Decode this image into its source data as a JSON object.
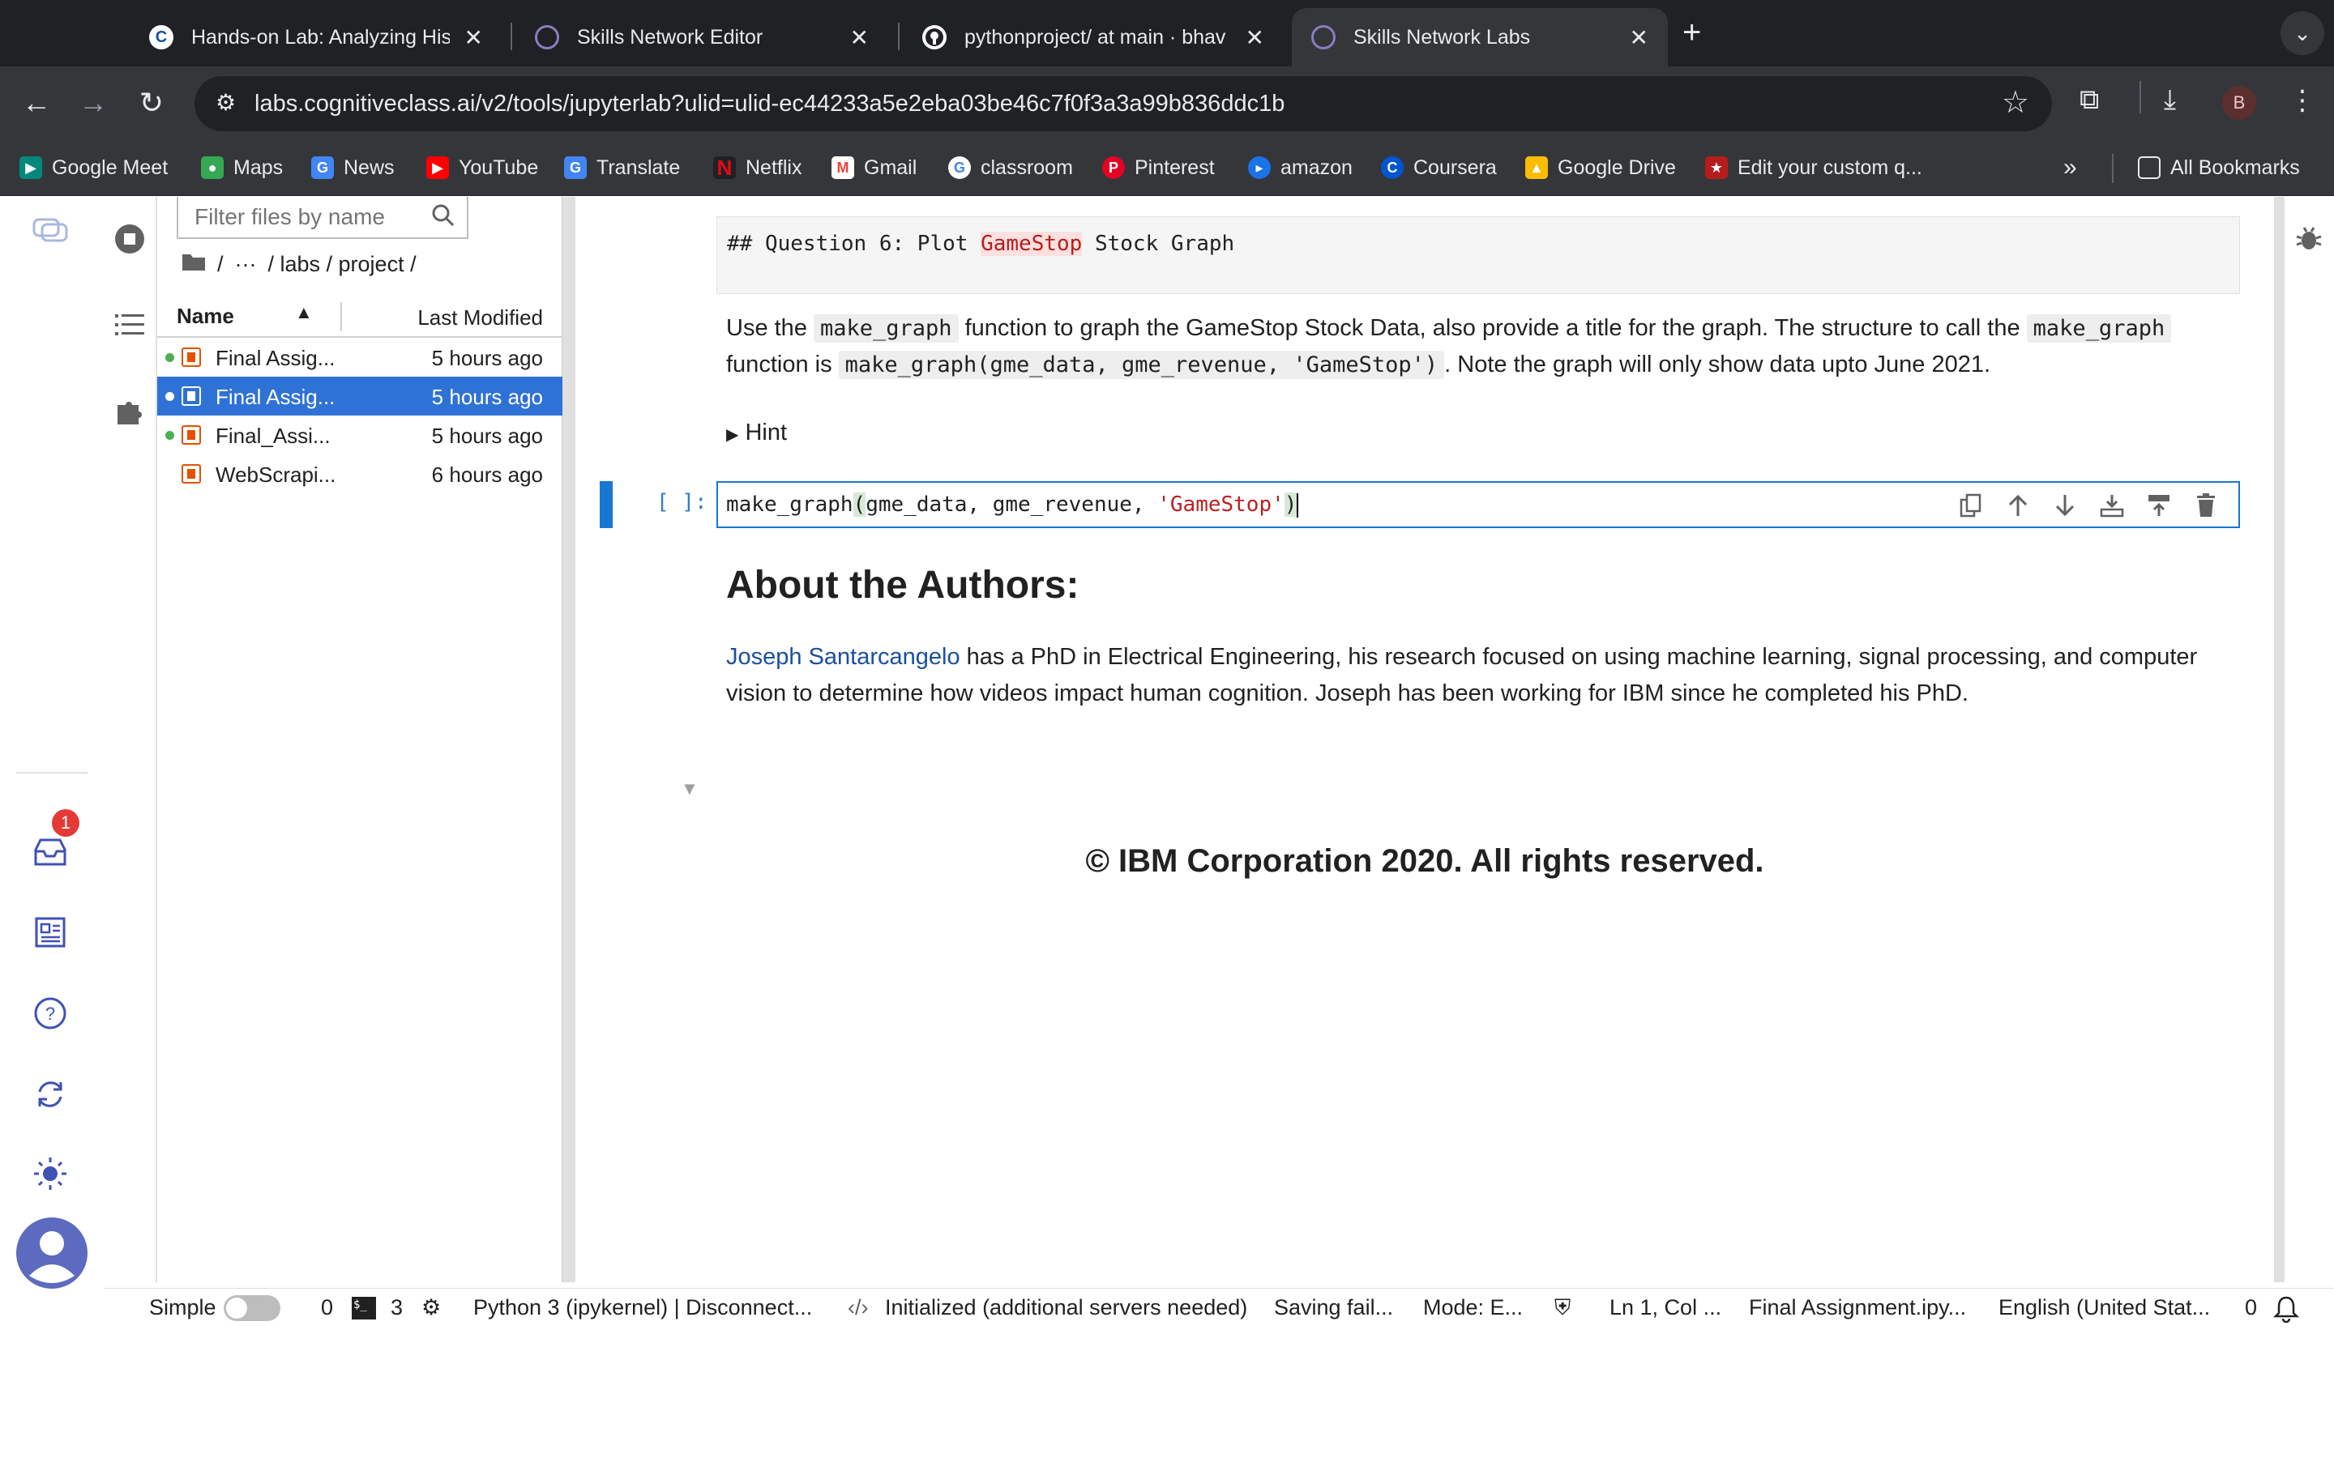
{
  "browser": {
    "tabs": [
      {
        "title": "Hands-on Lab: Analyzing Histo",
        "favicon": "C",
        "active": false
      },
      {
        "title": "Skills Network Editor",
        "favicon": "skills-network-icon",
        "active": false
      },
      {
        "title": "pythonproject/ at main · bhav",
        "favicon": "github-icon",
        "active": false
      },
      {
        "title": "Skills Network Labs",
        "favicon": "skills-network-icon",
        "active": true
      }
    ],
    "url": "labs.cognitiveclass.ai/v2/tools/jupyterlab?ulid=ulid-ec44233a5e2eba03be46c7f0f3a3a99b836ddc1b",
    "profile_initial": "B",
    "bookmarks": [
      {
        "label": "Google Meet",
        "color": "#00897b"
      },
      {
        "label": "Maps",
        "color": "#34a853"
      },
      {
        "label": "News",
        "color": "#4285f4"
      },
      {
        "label": "YouTube",
        "color": "#ff0000"
      },
      {
        "label": "Translate",
        "color": "#4285f4"
      },
      {
        "label": "Netflix",
        "color": "#e50914"
      },
      {
        "label": "Gmail",
        "color": "#ea4335"
      },
      {
        "label": "classroom",
        "color": "#4285f4"
      },
      {
        "label": "Pinterest",
        "color": "#e60023"
      },
      {
        "label": "amazon",
        "color": "#1a73e8"
      },
      {
        "label": "Coursera",
        "color": "#0056d2"
      },
      {
        "label": "Google Drive",
        "color": "#fbbc04"
      },
      {
        "label": "Edit your custom q...",
        "color": "#b71c1c"
      }
    ],
    "all_bookmarks": "All Bookmarks"
  },
  "filebrowser": {
    "filter_placeholder": "Filter files by name",
    "breadcrumb": [
      "/",
      "···",
      "/ labs / project /"
    ],
    "col_name": "Name",
    "col_modified": "Last Modified",
    "files": [
      {
        "name": "Final Assig...",
        "modified": "5 hours ago",
        "running": true,
        "selected": false
      },
      {
        "name": "Final Assig...",
        "modified": "5 hours ago",
        "running": true,
        "selected": true
      },
      {
        "name": "Final_Assi...",
        "modified": "5 hours ago",
        "running": true,
        "selected": false
      },
      {
        "name": "WebScrapi...",
        "modified": "6 hours ago",
        "running": false,
        "selected": false
      }
    ]
  },
  "notebook": {
    "md_source": "## Question 6: Plot ",
    "md_source_hl": "GameStop",
    "md_source_end": " Stock Graph",
    "para1": {
      "a": "Use the ",
      "code1": "make_graph",
      "b": " function to graph the GameStop Stock Data, also provide a title for the graph. The structure to call the ",
      "code2": "make_graph",
      "c": "function is ",
      "code3": "make_graph(gme_data, gme_revenue, 'GameStop')",
      "d": ". Note the graph will only show data upto June 2021."
    },
    "hint": "Hint",
    "prompt": "[ ]:",
    "code_pre": "make_graph",
    "code_paren": "(",
    "code_args": "gme_data, gme_revenue, ",
    "code_str": "'GameStop'",
    "code_close": ")",
    "authors_heading": "About the Authors:",
    "author_link": "Joseph Santarcangelo",
    "author_text1": " has a PhD in Electrical Engineering, his research focused on using machine learning, signal processing, and computer",
    "author_text2": "vision to determine how videos impact human cognition. Joseph has been working for IBM since he completed his PhD.",
    "copyright": "© IBM Corporation 2020. All rights reserved."
  },
  "leftbar": {
    "notification_count": "1"
  },
  "statusbar": {
    "mode_label": "Simple",
    "kernels": "0",
    "terminals": "3",
    "kernel_status": "Python 3 (ipykernel) | Disconnect...",
    "lsp": "Initialized (additional servers needed)",
    "saving": "Saving fail...",
    "mode": "Mode: E...",
    "position": "Ln 1, Col ...",
    "file": "Final Assignment.ipy...",
    "language": "English (United Stat...",
    "notifications": "0"
  }
}
